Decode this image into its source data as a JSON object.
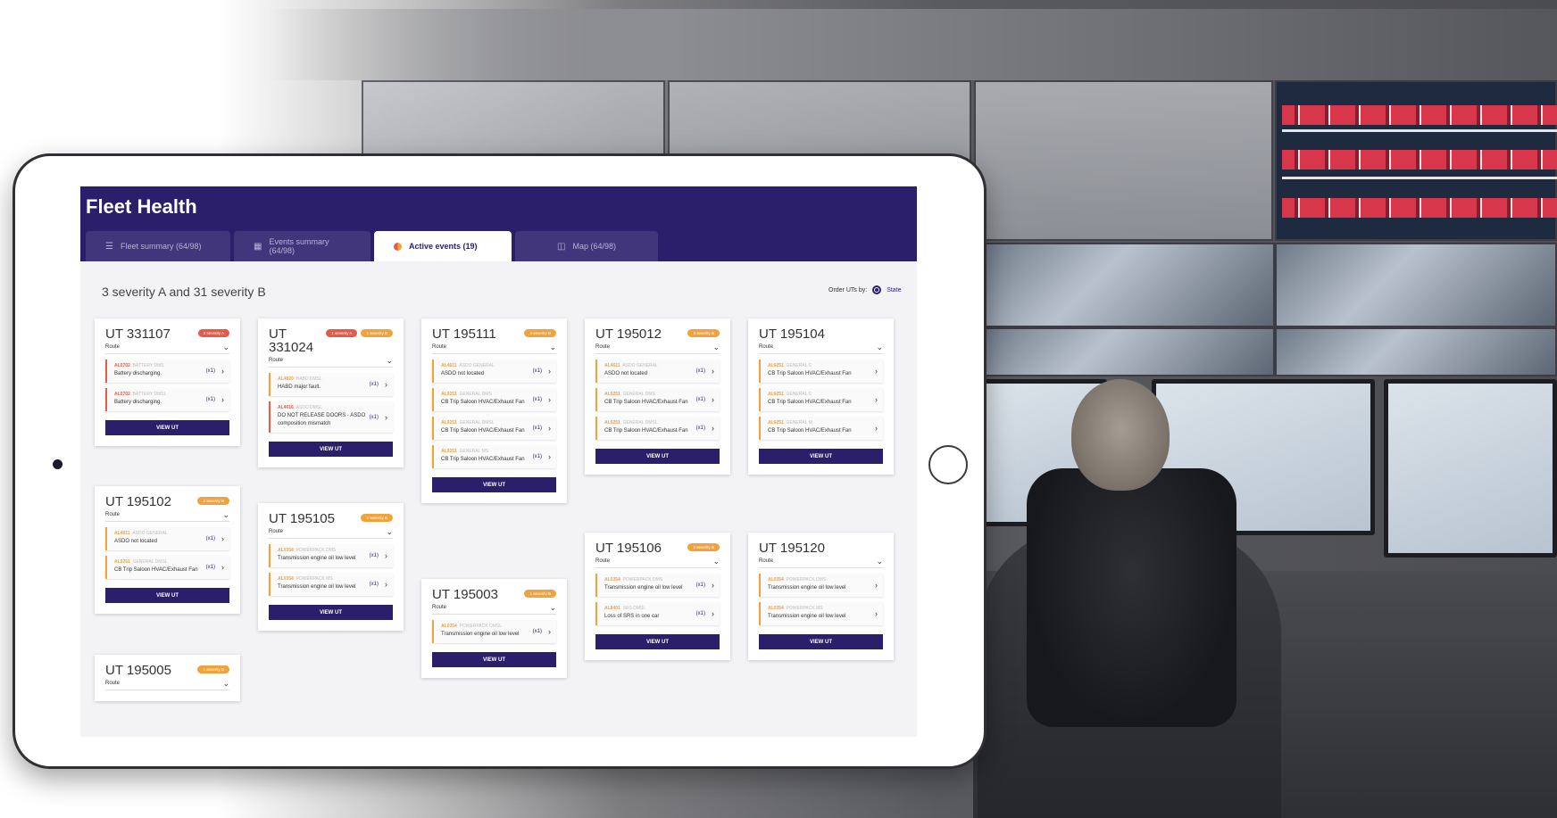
{
  "app": {
    "title": "Fleet Health",
    "tabs": [
      {
        "label": "Fleet summary (64/98)",
        "icon": "list-icon"
      },
      {
        "label": "Events summary (64/98)",
        "icon": "calendar-icon"
      },
      {
        "label": "Active events (19)",
        "icon": "severity-dot-icon"
      },
      {
        "label": "Map (64/98)",
        "icon": "map-icon"
      }
    ],
    "active_tab": "Active events (19)",
    "summary": "3 severity A and 31 severity B",
    "order_label": "Order UTs by:",
    "order_value": "State",
    "route_label": "Route",
    "view_label": "VIEW UT",
    "colors": {
      "header": "#2b1f6b",
      "severity_a": "#e65a4a",
      "severity_b": "#f0a33c"
    }
  },
  "cards": [
    {
      "ut": "UT 331107",
      "badges": [
        {
          "label": "2 severity A",
          "type": "a"
        }
      ],
      "events": [
        {
          "code": "AL0702",
          "tags": "BATTERY  DMS",
          "desc": "Battery discharging.",
          "count": "(x1)",
          "sev": "a"
        },
        {
          "code": "AL0702",
          "tags": "BATTERY  DMSL",
          "desc": "Battery discharging.",
          "count": "(x1)",
          "sev": "a"
        }
      ]
    },
    {
      "ut": "UT 195102",
      "badges": [
        {
          "label": "2 severity B",
          "type": "b"
        }
      ],
      "events": [
        {
          "code": "AL4611",
          "tags": "ASDO  GENERAL",
          "desc": "ASDO not located",
          "count": "(x1)",
          "sev": "b"
        },
        {
          "code": "AL9251",
          "tags": "GENERAL  DMSL",
          "desc": "CB Trip Saloon HVAC/Exhaust Fan",
          "count": "(x1)",
          "sev": "b"
        }
      ]
    },
    {
      "ut": "UT 195005",
      "badges": [
        {
          "label": "1 severity B",
          "type": "b"
        }
      ],
      "events": []
    },
    {
      "ut": "UT 331024",
      "badges": [
        {
          "label": "1 severity A",
          "type": "a"
        },
        {
          "label": "1 severity B",
          "type": "b"
        }
      ],
      "events": [
        {
          "code": "AL4820",
          "tags": "HABD  DMSL",
          "desc": "HABD major fault.",
          "count": "(x1)",
          "sev": "b"
        },
        {
          "code": "AL4616",
          "tags": "ASDO  DMSL",
          "desc": "DO NOT RELEASE DOORS - ASDO composition mismatch",
          "count": "(x1)",
          "sev": "a"
        }
      ]
    },
    {
      "ut": "UT 195105",
      "badges": [
        {
          "label": "2 severity B",
          "type": "b"
        }
      ],
      "events": [
        {
          "code": "AL0354",
          "tags": "POWERPACK  DMS",
          "desc": "Transmission engine oil low level",
          "count": "(x1)",
          "sev": "b"
        },
        {
          "code": "AL0354",
          "tags": "POWERPACK  MS",
          "desc": "Transmission engine oil low level",
          "count": "(x1)",
          "sev": "b"
        }
      ]
    },
    {
      "ut": "UT 195111",
      "badges": [
        {
          "label": "4 severity B",
          "type": "b"
        }
      ],
      "events": [
        {
          "code": "AL4611",
          "tags": "ASDO  GENERAL",
          "desc": "ASDO not located",
          "count": "(x1)",
          "sev": "b"
        },
        {
          "code": "AL9251",
          "tags": "GENERAL  DMS",
          "desc": "CB Trip Saloon HVAC/Exhaust Fan",
          "count": "(x1)",
          "sev": "b"
        },
        {
          "code": "AL9251",
          "tags": "GENERAL  DMSL",
          "desc": "CB Trip Saloon HVAC/Exhaust Fan",
          "count": "(x1)",
          "sev": "b"
        },
        {
          "code": "AL9251",
          "tags": "GENERAL  MS",
          "desc": "CB Trip Saloon HVAC/Exhaust Fan",
          "count": "(x1)",
          "sev": "b"
        }
      ]
    },
    {
      "ut": "UT 195003",
      "badges": [
        {
          "label": "1 severity B",
          "type": "b"
        }
      ],
      "events": [
        {
          "code": "AL0354",
          "tags": "POWERPACK  DMSL",
          "desc": "Transmission engine oil low level",
          "count": "(x1)",
          "sev": "b"
        }
      ]
    },
    {
      "ut": "UT 195012",
      "badges": [
        {
          "label": "3 severity B",
          "type": "b"
        }
      ],
      "events": [
        {
          "code": "AL4611",
          "tags": "ASDO  GENERAL",
          "desc": "ASDO not located",
          "count": "(x1)",
          "sev": "b"
        },
        {
          "code": "AL9251",
          "tags": "GENERAL  DMS",
          "desc": "CB Trip Saloon HVAC/Exhaust Fan",
          "count": "(x1)",
          "sev": "b"
        },
        {
          "code": "AL9251",
          "tags": "GENERAL  DMSL",
          "desc": "CB Trip Saloon HVAC/Exhaust Fan",
          "count": "(x1)",
          "sev": "b"
        }
      ]
    },
    {
      "ut": "UT 195106",
      "badges": [
        {
          "label": "2 severity B",
          "type": "b"
        }
      ],
      "events": [
        {
          "code": "AL0354",
          "tags": "POWERPACK  DMS",
          "desc": "Transmission engine oil low level",
          "count": "(x1)",
          "sev": "b"
        },
        {
          "code": "AL8401",
          "tags": "SRS  DMSL",
          "desc": "Loss of SRS in one car",
          "count": "(x1)",
          "sev": "b"
        }
      ]
    },
    {
      "ut": "UT 195104",
      "badges": [],
      "events": [
        {
          "code": "AL9251",
          "tags": "GENERAL  C",
          "desc": "CB Trip Saloon HVAC/Exhaust Fan",
          "count": "",
          "sev": "b"
        },
        {
          "code": "AL9251",
          "tags": "GENERAL  C",
          "desc": "CB Trip Saloon HVAC/Exhaust Fan",
          "count": "",
          "sev": "b"
        },
        {
          "code": "AL9251",
          "tags": "GENERAL  M",
          "desc": "CB Trip Saloon HVAC/Exhaust Fan",
          "count": "",
          "sev": "b"
        }
      ]
    },
    {
      "ut": "UT 195120",
      "badges": [],
      "events": [
        {
          "code": "AL0354",
          "tags": "POWERPACK  DMS",
          "desc": "Transmission engine oil low level",
          "count": "",
          "sev": "b"
        },
        {
          "code": "AL0354",
          "tags": "POWERPACK  MS",
          "desc": "Transmission engine oil low level",
          "count": "",
          "sev": "b"
        }
      ]
    }
  ]
}
